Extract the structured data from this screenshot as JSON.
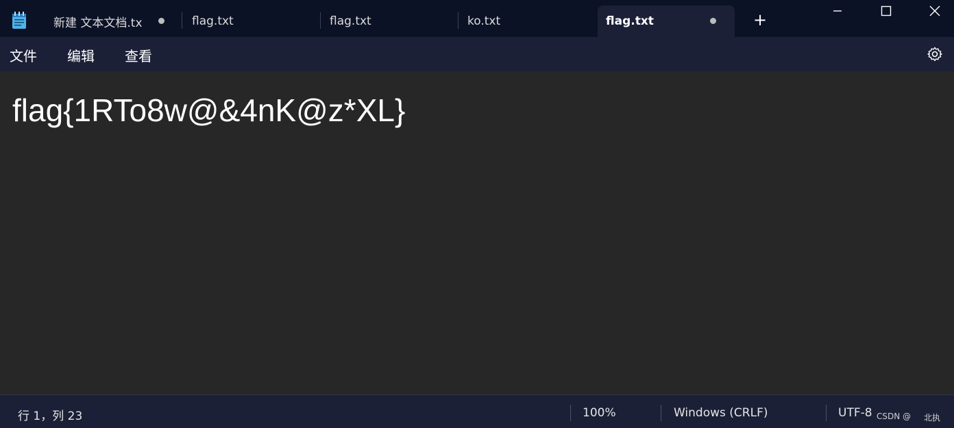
{
  "tabs": [
    {
      "label": "新建 文本文档.tx",
      "unsaved": true,
      "active": false
    },
    {
      "label": "flag.txt",
      "unsaved": false,
      "active": false
    },
    {
      "label": "flag.txt",
      "unsaved": false,
      "active": false
    },
    {
      "label": "ko.txt",
      "unsaved": false,
      "active": false
    },
    {
      "label": "flag.txt",
      "unsaved": true,
      "active": true
    }
  ],
  "new_tab_symbol": "+",
  "menu": {
    "file": "文件",
    "edit": "编辑",
    "view": "查看"
  },
  "editor": {
    "content": "flag{1RTo8w@&4nK@z*XL}"
  },
  "status": {
    "position": "行 1，列 23",
    "zoom": "100%",
    "line_ending": "Windows (CRLF)",
    "encoding": "UTF-8"
  },
  "watermark": {
    "site": "CSDN @",
    "author": "北执"
  },
  "colors": {
    "titlebar": "#0c1226",
    "menubar": "#1b2037",
    "editor_bg": "#272727",
    "text": "#ffffff"
  }
}
